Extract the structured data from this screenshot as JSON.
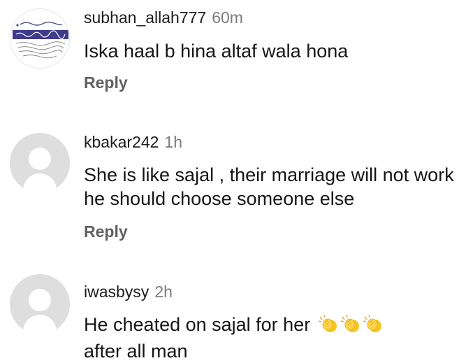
{
  "comments": [
    {
      "username": "subhan_allah777",
      "time": "60m",
      "text": "Iska haal b hina altaf wala hona",
      "reply_label": "Reply",
      "avatar": "custom-image-avatar"
    },
    {
      "username": "kbakar242",
      "time": "1h",
      "text": "She is like sajal , their marriage will not work he should choose someone else",
      "reply_label": "Reply",
      "avatar": "default-user-avatar"
    },
    {
      "username": "iwasbysy",
      "time": "2h",
      "text_before_emoji": "He cheated on sajal for her",
      "text_after_emoji": "after all man",
      "emoji": [
        "clapping-hands-icon",
        "clapping-hands-icon",
        "clapping-hands-icon"
      ],
      "avatar": "default-user-avatar"
    }
  ],
  "colors": {
    "username": "#1c1c1c",
    "timestamp": "#7b7b7b",
    "reply": "#606060",
    "avatar_placeholder": "#dedede",
    "clap_emoji": "#f7c325"
  }
}
